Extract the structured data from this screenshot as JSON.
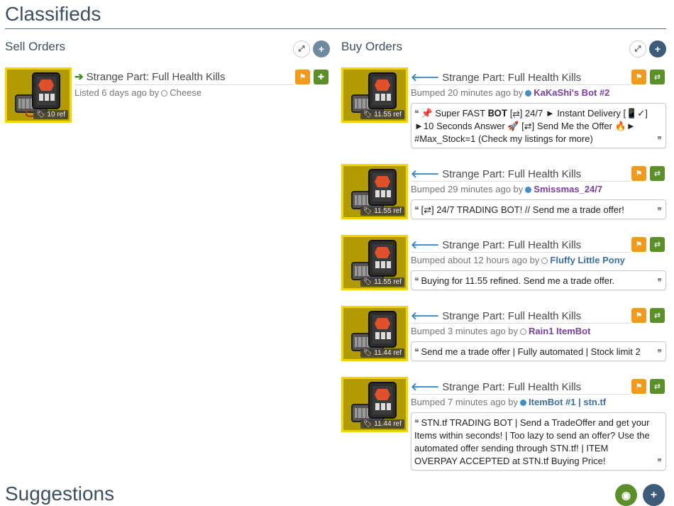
{
  "page_title": "Classifieds",
  "sell": {
    "title": "Sell Orders",
    "listings": [
      {
        "item": "Strange Part: Full Health Kills",
        "price": "10 ref",
        "meta_prefix": "Listed 6 days ago by",
        "user": "Cheese",
        "status": "offline"
      }
    ]
  },
  "buy": {
    "title": "Buy Orders",
    "listings": [
      {
        "item": "Strange Part: Full Health Kills",
        "price": "11.55 ref",
        "meta_prefix": "Bumped 20 minutes ago by",
        "user": "KaKaShi's Bot #2",
        "status": "online",
        "comment": "📌 Super FAST 𝐁𝐎𝐓 [⇄] 24/7 ► Instant Delivery [📱✓] ►10 Seconds Answer 🚀 [⇄] Send Me the Offer 🔥► #Max_Stock=1 (Check my listings for more)"
      },
      {
        "item": "Strange Part: Full Health Kills",
        "price": "11.55 ref",
        "meta_prefix": "Bumped 29 minutes ago by",
        "user": "Smissmas_24/7",
        "status": "online",
        "comment": "[⇄] 24/7 TRADING BOT! // Send me a trade offer!"
      },
      {
        "item": "Strange Part: Full Health Kills",
        "price": "11.55 ref",
        "meta_prefix": "Bumped about 12 hours ago by",
        "user": "Fluffy Little Pony",
        "status": "offline",
        "comment": "Buying for 11.55 refined. Send me a trade offer."
      },
      {
        "item": "Strange Part: Full Health Kills",
        "price": "11.44 ref",
        "meta_prefix": "Bumped 3 minutes ago by",
        "user": "Rain1 ItemBot",
        "status": "offline",
        "comment": "Send me a trade offer | Fully automated | Stock limit 2"
      },
      {
        "item": "Strange Part: Full Health Kills",
        "price": "11.44 ref",
        "meta_prefix": "Bumped 7 minutes ago by",
        "user": "ItemBot #1 | stn.tf",
        "status": "online",
        "comment": "STN.tf TRADING BOT | Send a TradeOffer and get your Items within seconds! | Too lazy to send an offer? Use the automated offer sending through STN.tf! | ITEM OVERPAY ACCEPTED at STN.tf Buying Price!"
      }
    ]
  },
  "suggestions_title": "Suggestions",
  "icons": {
    "expand": "expand-icon",
    "add": "plus-icon",
    "flag": "flag-icon",
    "trade": "exchange-icon",
    "view": "eye-slash-icon",
    "tag": "tag-icon",
    "quote_open": "quote-left-icon",
    "quote_close": "quote-right-icon"
  },
  "colors": {
    "accent": "#3c4f61",
    "orange": "#f29a1c",
    "green": "#5b8f2a",
    "online": "#3f8ec7",
    "username": "#7a3e9d"
  }
}
